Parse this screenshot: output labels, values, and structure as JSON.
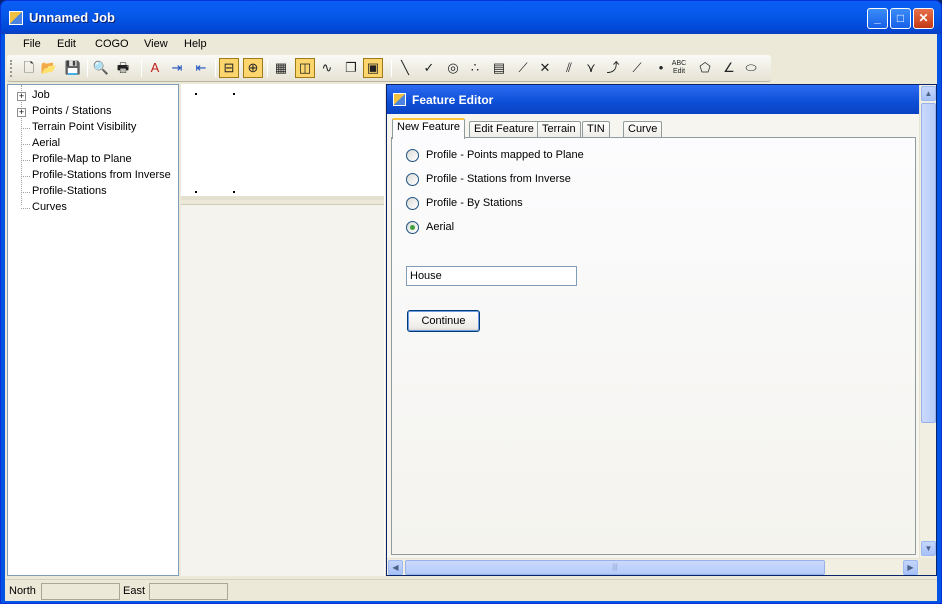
{
  "window": {
    "title": "Unnamed Job",
    "minimize": "_",
    "maximize": "□",
    "close": "✕"
  },
  "menu": [
    "File",
    "Edit",
    "COGO",
    "View",
    "Help"
  ],
  "toolbar": {
    "icons": [
      "new-file-icon",
      "open-folder-icon",
      "save-icon",
      "print-preview-icon",
      "print-icon",
      "text-style-icon",
      "import-icon",
      "export-icon",
      "tree-view-icon",
      "zoom-extents-icon",
      "grid-icon",
      "layer-icon",
      "line-style-icon",
      "properties-icon",
      "feature-icon",
      "line-icon",
      "check-line-icon",
      "circle-point-icon",
      "points-icon",
      "building-icon",
      "polyline-icon",
      "intersect-icon",
      "offset-icon",
      "vertex-icon",
      "curve-icon",
      "measure-icon",
      "point-icon",
      "abc-edit-icon",
      "area-icon",
      "angle-icon",
      "shape-icon"
    ],
    "glyphs": [
      "🗋",
      "📂",
      "💾",
      "🔍",
      "🖶",
      "A",
      "⇥",
      "⇤",
      "⊟",
      "⊕",
      "▦",
      "◫",
      "∿",
      "❐",
      "▣",
      "╲",
      "✓",
      "◎",
      "∴",
      "▤",
      "⟋",
      "✕",
      "⫽",
      "⋎",
      "⤴",
      "⟋",
      "•",
      "ABC",
      "⬠",
      "∠",
      "⬭"
    ],
    "abc_label": "ABC",
    "abc_sub": "Edit"
  },
  "tree": {
    "items": [
      {
        "label": "Job",
        "expandable": true
      },
      {
        "label": "Points / Stations",
        "expandable": true
      },
      {
        "label": "Terrain Point Visibility",
        "expandable": false
      },
      {
        "label": "Aerial",
        "expandable": false
      },
      {
        "label": "Profile-Map to Plane",
        "expandable": false
      },
      {
        "label": "Profile-Stations from Inverse",
        "expandable": false
      },
      {
        "label": "Profile-Stations",
        "expandable": false
      },
      {
        "label": "Curves",
        "expandable": false
      }
    ],
    "expander": "+"
  },
  "editor": {
    "title": "Feature Editor",
    "tabs": [
      "New Feature",
      "Edit Feature",
      "Terrain",
      "TIN",
      "Curve"
    ],
    "active_tab": "New Feature",
    "options": [
      {
        "label": "Profile - Points mapped to Plane",
        "checked": false
      },
      {
        "label": "Profile - Stations from Inverse",
        "checked": false
      },
      {
        "label": "Profile - By Stations",
        "checked": false
      },
      {
        "label": "Aerial",
        "checked": true
      }
    ],
    "name_value": "House",
    "continue_label": "Continue"
  },
  "scroll": {
    "up": "▲",
    "down": "▼",
    "left": "◀",
    "right": "▶",
    "grip": "|||",
    "grip_v": "≡"
  },
  "status": {
    "north_label": "North",
    "north_value": "",
    "east_label": "East",
    "east_value": ""
  },
  "colors": {
    "title_blue": "#0054e3",
    "active_tab_accent": "#ffc83c",
    "radio_check": "#3fa23f"
  }
}
